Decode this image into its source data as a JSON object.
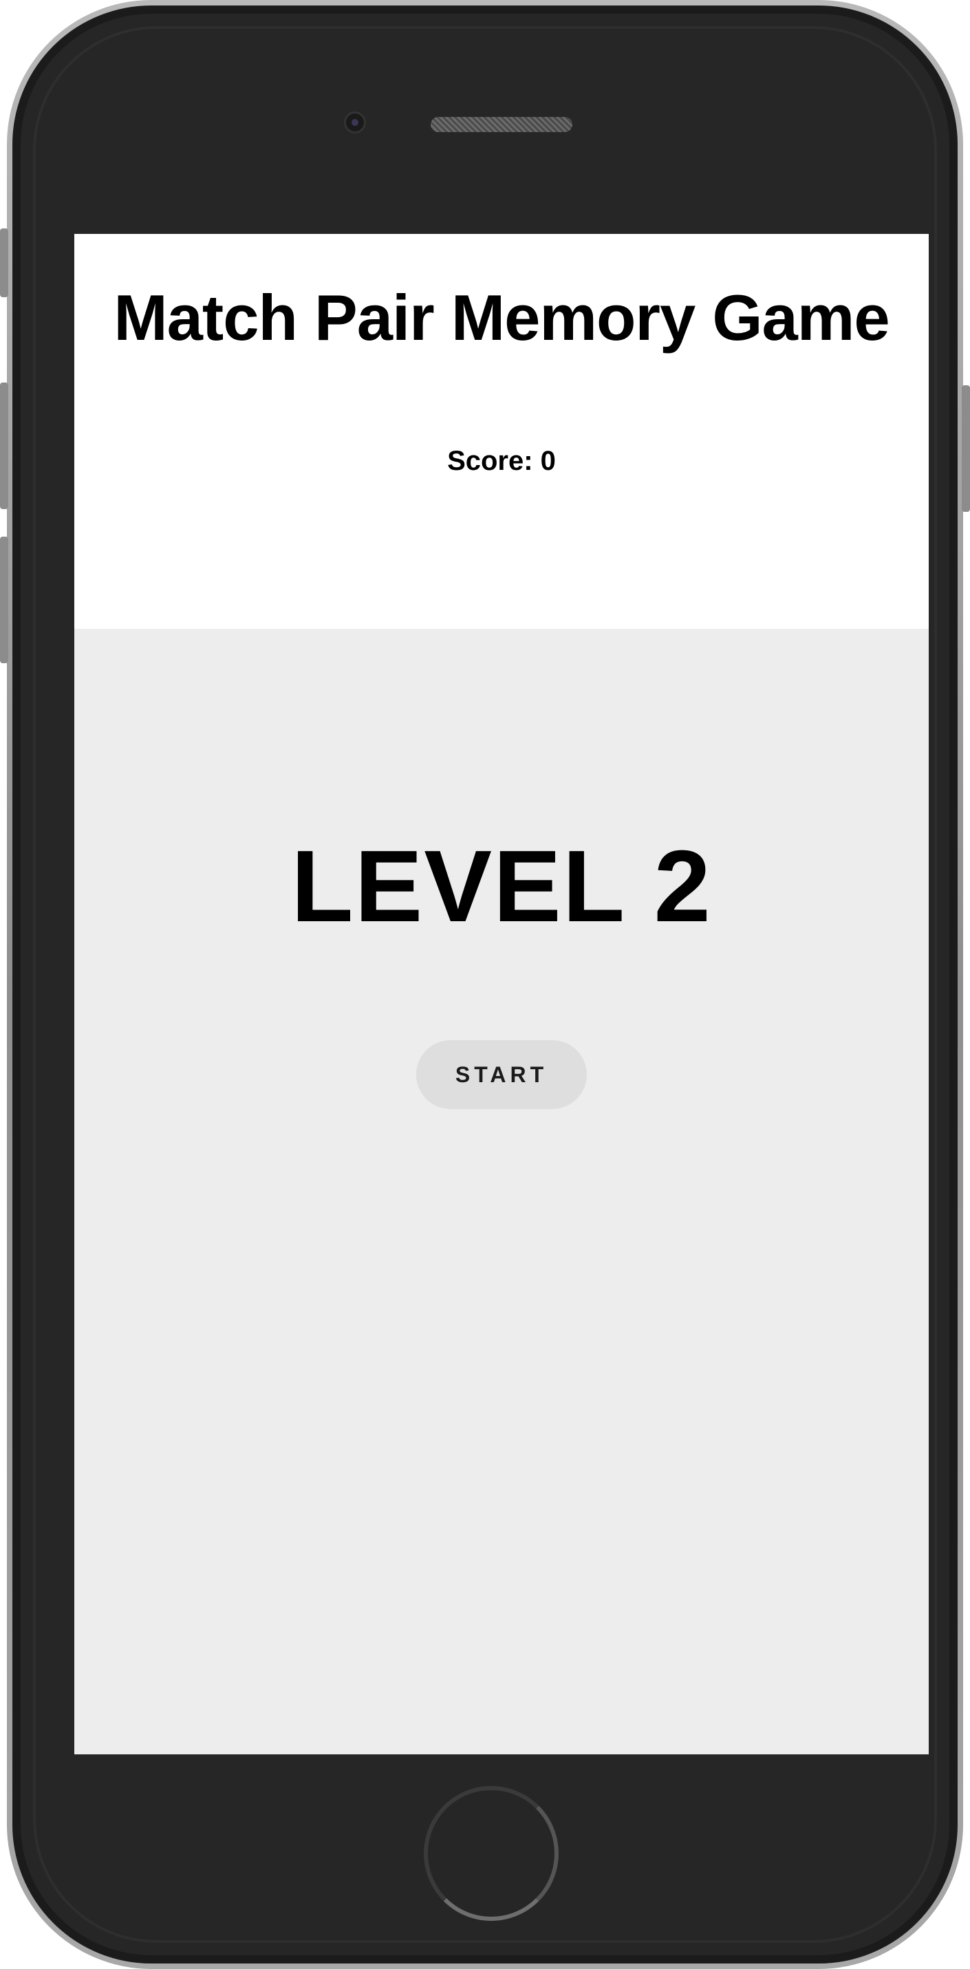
{
  "app": {
    "title": "Match Pair Memory Game",
    "score_text": "Score: 0"
  },
  "game": {
    "level_text": "LEVEL 2",
    "start_label": "START"
  },
  "colors": {
    "game_area_bg": "#ededed",
    "start_button_bg": "#dedede",
    "device_frame": "#262626"
  }
}
